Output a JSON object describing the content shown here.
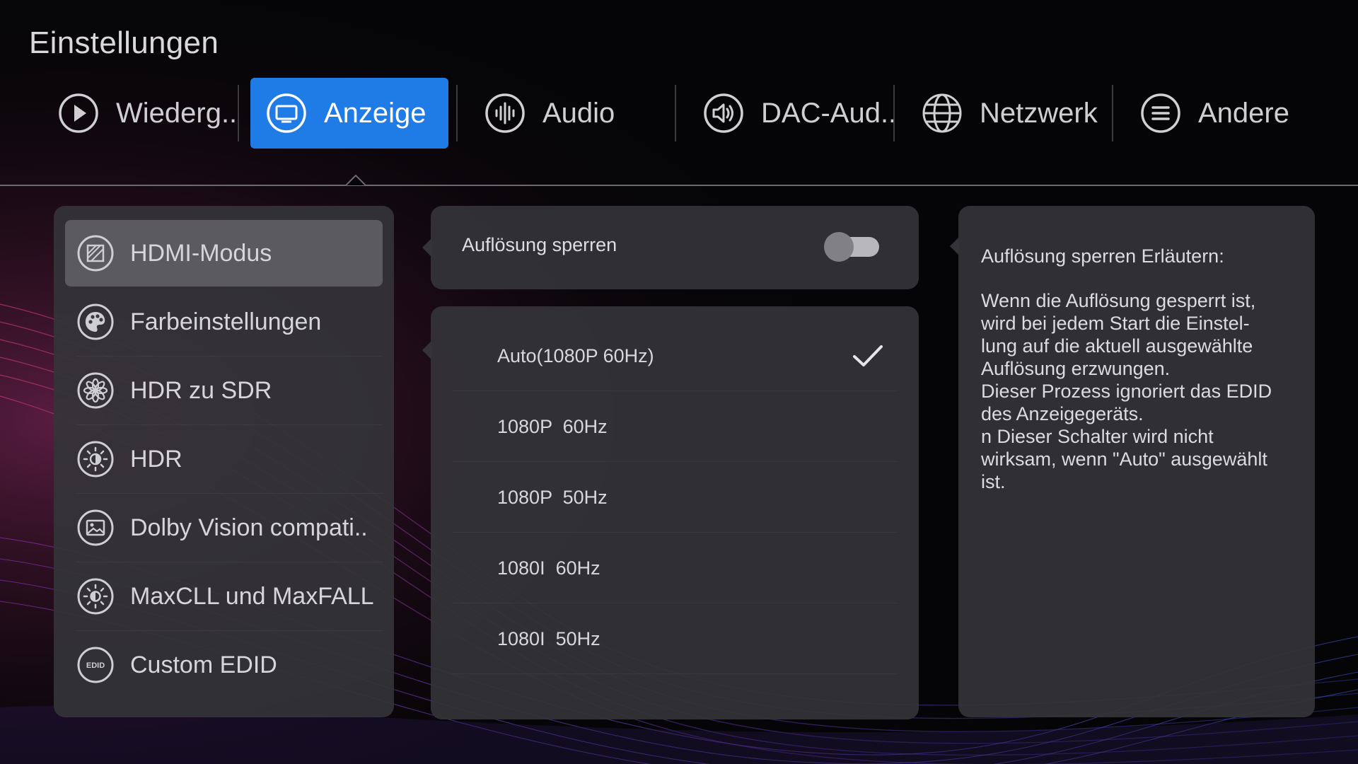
{
  "page_title": "Einstellungen",
  "tabs": [
    {
      "label": "Wiederg..",
      "icon": "play-icon"
    },
    {
      "label": "Anzeige",
      "icon": "monitor-icon",
      "active": true
    },
    {
      "label": "Audio",
      "icon": "audio-waveform-icon"
    },
    {
      "label": "DAC-Aud..",
      "icon": "speaker-icon"
    },
    {
      "label": "Netzwerk",
      "icon": "globe-icon"
    },
    {
      "label": "Andere",
      "icon": "menu-lines-icon"
    }
  ],
  "sidebar": {
    "items": [
      {
        "label": "HDMI-Modus",
        "icon": "hdmi-mode-icon",
        "selected": true
      },
      {
        "label": "Farbeinstellungen",
        "icon": "palette-icon"
      },
      {
        "label": "HDR zu SDR",
        "icon": "flower-aperture-icon"
      },
      {
        "label": "HDR",
        "icon": "hdr-sun-icon"
      },
      {
        "label": "Dolby Vision compati..",
        "icon": "picture-icon"
      },
      {
        "label": "MaxCLL und MaxFALL",
        "icon": "brightness-icon"
      },
      {
        "label": "Custom EDID",
        "icon": "edid-icon",
        "badge": "EDID"
      }
    ]
  },
  "lock_resolution": {
    "label": "Auflösung sperren",
    "enabled": false
  },
  "resolutions": {
    "items": [
      {
        "label": "Auto(1080P 60Hz)",
        "checked": true
      },
      {
        "label": "1080P  60Hz"
      },
      {
        "label": "1080P  50Hz"
      },
      {
        "label": "1080I  60Hz"
      },
      {
        "label": "1080I  50Hz"
      }
    ]
  },
  "info": {
    "title": "Auflösung sperren Erläutern:",
    "lines": [
      "Wenn die Auflösung gesperrt ist,",
      "wird bei jedem Start die Einstel-",
      "lung auf die aktuell ausgewählte",
      "Auflösung erzwungen.",
      "Dieser Prozess ignoriert das EDID",
      "des Anzeigegeräts.",
      "n Dieser Schalter wird nicht",
      "wirksam, wenn \"Auto\" ausgewählt",
      "ist."
    ]
  },
  "colors": {
    "accent": "#1f7be6",
    "background": "#050507",
    "panel": "#343438",
    "selected_item": "#5a5a5f"
  }
}
